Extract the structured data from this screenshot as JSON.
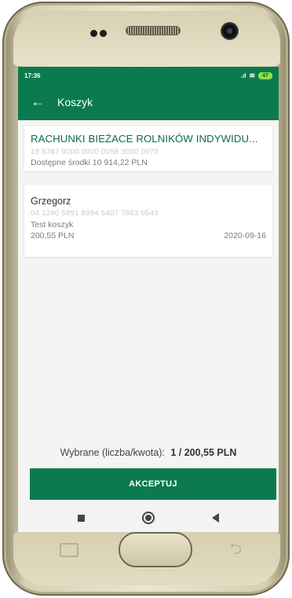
{
  "status_bar": {
    "time": "17:36",
    "battery_level": "47",
    "icons": [
      "signal-icon",
      "wifi-icon",
      "battery-icon"
    ]
  },
  "app_bar": {
    "title": "Koszyk",
    "back_icon": "back-arrow-icon"
  },
  "account": {
    "name": "RACHUNKI BIEŻACE ROLNIKÓW INDYWIDU...",
    "number": "18 8787 0000 0000 0058 3000 0070",
    "available_funds": "Dostępne środki 10 914,22 PLN"
  },
  "transfers": [
    {
      "recipient": "Grzegorz",
      "account": "04 1240 5891 8994 5407 7863 0549",
      "title": "Test koszyk",
      "amount": "200,55 PLN",
      "date": "2020-09-16"
    }
  ],
  "summary": {
    "label": "Wybrane (liczba/kwota):",
    "value": "1 / 200,55 PLN"
  },
  "accept_button": {
    "label": "AKCEPTUJ"
  },
  "colors": {
    "brand_green": "#0b7a4f",
    "account_name_green": "#0b6d43"
  },
  "system_nav": {
    "icons": [
      "recent-apps-icon",
      "home-icon",
      "back-icon"
    ]
  }
}
